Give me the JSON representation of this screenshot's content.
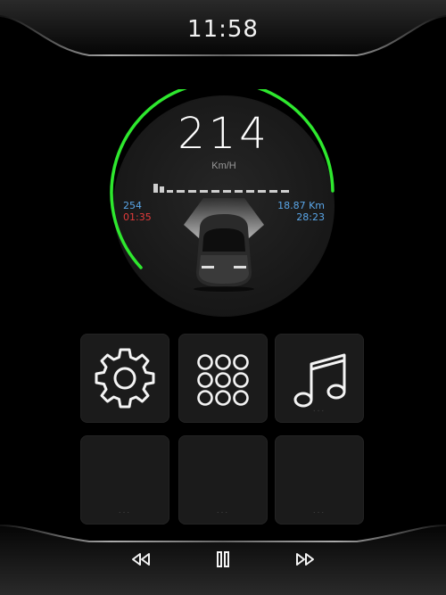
{
  "status": {
    "time": "11:58"
  },
  "speedometer": {
    "speed": "214",
    "unit": "Km/H",
    "left_top": "254",
    "left_bottom": "01:35",
    "right_top": "18.87 Km",
    "right_bottom": "28:23",
    "arc_color": "#2ee82e",
    "left_bottom_color": "#e23b3b",
    "info_color": "#5aa6e8"
  },
  "tiles": [
    {
      "icon": "gear-icon"
    },
    {
      "icon": "apps-grid-icon"
    },
    {
      "icon": "music-note-icon"
    },
    {
      "icon": "empty"
    },
    {
      "icon": "empty"
    },
    {
      "icon": "empty"
    }
  ],
  "tile_dots": "...",
  "media_controls": [
    {
      "icon": "rewind-icon"
    },
    {
      "icon": "pause-icon"
    },
    {
      "icon": "fast-forward-icon"
    }
  ]
}
